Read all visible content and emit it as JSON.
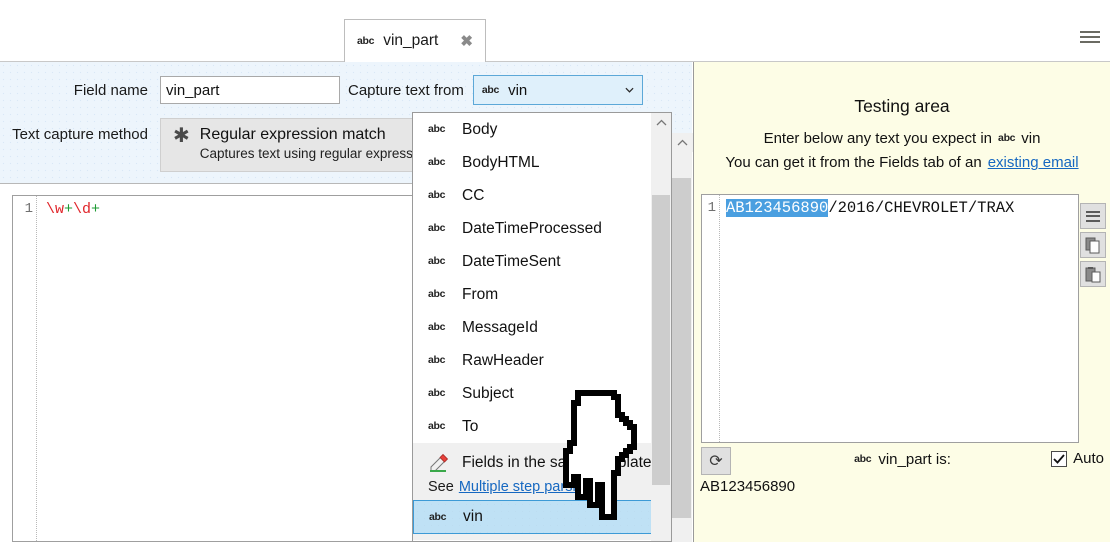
{
  "window": {
    "hamburger_icon": "hamburger-menu-icon"
  },
  "tab": {
    "type_icon": "abc",
    "label": "vin_part",
    "close_icon": "✖"
  },
  "form": {
    "field_name_label": "Field name",
    "field_name_value": "vin_part",
    "capture_from_label": "Capture text from",
    "capture_from_icon": "abc",
    "capture_from_value": "vin",
    "method_label": "Text capture method",
    "method_icon": "✱",
    "method_title": "Regular expression match",
    "method_subtitle": "Captures text using regular expressions"
  },
  "editor": {
    "line_number": "1",
    "code": "\\w+\\d+",
    "tokens": [
      {
        "text": "\\w",
        "kind": "escape"
      },
      {
        "text": "+",
        "kind": "quantifier"
      },
      {
        "text": "\\d",
        "kind": "escape"
      },
      {
        "text": "+",
        "kind": "quantifier"
      }
    ]
  },
  "dropdown": {
    "items": [
      {
        "icon": "abc",
        "label": "Body"
      },
      {
        "icon": "abc",
        "label": "BodyHTML"
      },
      {
        "icon": "abc",
        "label": "CC"
      },
      {
        "icon": "abc",
        "label": "DateTimeProcessed"
      },
      {
        "icon": "abc",
        "label": "DateTimeSent"
      },
      {
        "icon": "abc",
        "label": "From"
      },
      {
        "icon": "abc",
        "label": "MessageId"
      },
      {
        "icon": "abc",
        "label": "RawHeader"
      },
      {
        "icon": "abc",
        "label": "Subject"
      },
      {
        "icon": "abc",
        "label": "To"
      }
    ],
    "group": {
      "icon": "pencil-icon",
      "label": "Fields in the same template",
      "note_prefix": "See",
      "note_link": "Multiple step parsing"
    },
    "selected": {
      "icon": "abc",
      "label": "vin"
    }
  },
  "testing": {
    "title": "Testing area",
    "line1_prefix": "Enter below any text you expect in",
    "line1_icon": "abc",
    "line1_field": "vin",
    "line2_prefix": "You can get it from the Fields tab of an",
    "line2_link": "existing email",
    "input": {
      "line_number": "1",
      "match": "AB123456890",
      "rest": "/2016/CHEVROLET/TRAX"
    },
    "side_buttons": [
      {
        "name": "menu-icon",
        "title": "Menu"
      },
      {
        "name": "copy-icon",
        "title": "Copy"
      },
      {
        "name": "paste-icon",
        "title": "Paste"
      }
    ],
    "refresh_icon": "⟳",
    "result_icon": "abc",
    "result_label": "vin_part is:",
    "auto_label": "Auto",
    "auto_checked": true,
    "result_value": "AB123456890"
  },
  "colors": {
    "form_panel_bg": "#edf5fc",
    "testing_panel_bg": "#fdfde6",
    "select_bg": "#dff0fb",
    "select_border": "#5ca8d8",
    "highlight_bg": "#4a9fe0",
    "link": "#1668c1",
    "regex_escape": "#e0252a",
    "regex_quantifier": "#1e9b34"
  }
}
